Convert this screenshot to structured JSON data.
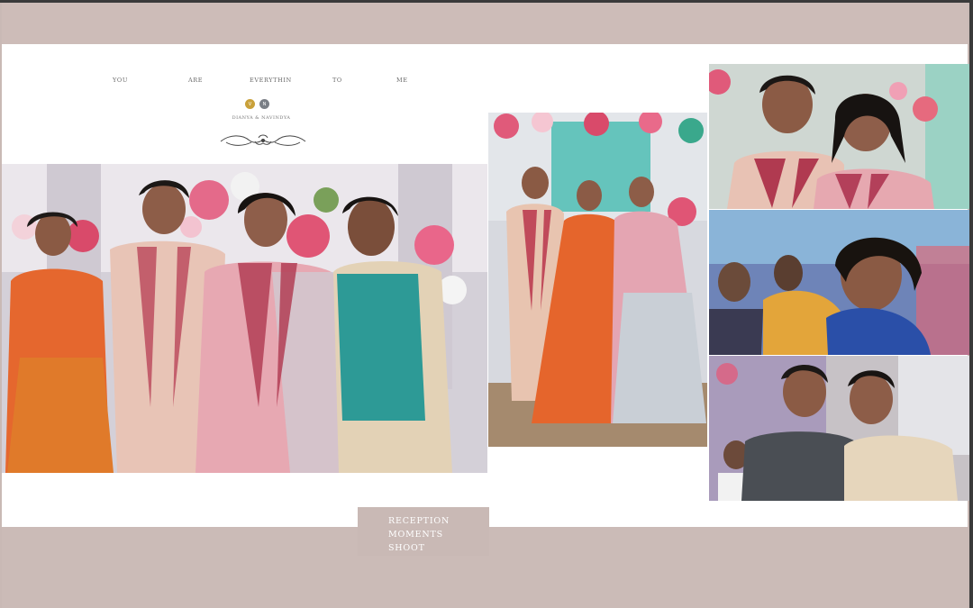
{
  "tagline": [
    "YOU",
    "ARE",
    "EVERYTHIN",
    "TO",
    "ME"
  ],
  "monogram": {
    "left": "V",
    "right": "N"
  },
  "names": "DIANYA & NAVINDYA",
  "caption": [
    "RECEPTION",
    "MOMENTS",
    "SHOOT"
  ],
  "colors": {
    "band": "#cdbcb8",
    "page": "#ffffff",
    "gold": "#c9a13a"
  },
  "photos": [
    {
      "name": "group-photo-main",
      "subject": "four people in festive attire with floral backdrop"
    },
    {
      "name": "couple-with-bridesmaid",
      "subject": "couple with woman in orange lehenga"
    },
    {
      "name": "couple-closeup",
      "subject": "smiling couple with flower garlands"
    },
    {
      "name": "embrace-moment",
      "subject": "two women embracing"
    },
    {
      "name": "two-men-portrait",
      "subject": "two men posing"
    }
  ]
}
